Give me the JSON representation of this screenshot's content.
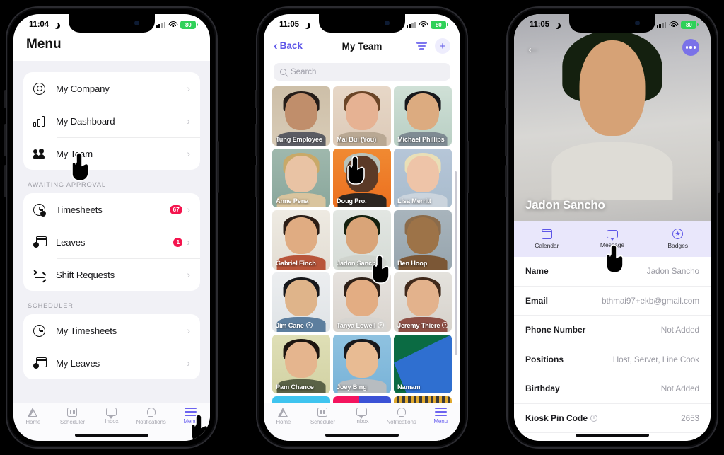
{
  "phones": [
    {
      "id": "menu-screen",
      "status": {
        "time": "11:04",
        "battery": "80",
        "moon_icon": "moon-icon",
        "signal_icon": "cellular-icon",
        "wifi_icon": "wifi-icon"
      },
      "title": "Menu",
      "groups": [
        {
          "label": "",
          "items": [
            {
              "icon": "gear-icon",
              "label": "My Company",
              "badge": ""
            },
            {
              "icon": "bar-chart-icon",
              "label": "My Dashboard",
              "badge": ""
            },
            {
              "icon": "people-icon",
              "label": "My Team",
              "badge": ""
            }
          ]
        },
        {
          "label": "AWAITING APPROVAL",
          "items": [
            {
              "icon": "clock-check-icon",
              "label": "Timesheets",
              "badge": "67"
            },
            {
              "icon": "calendar-minus-icon",
              "label": "Leaves",
              "badge": "1"
            },
            {
              "icon": "swap-arrows-icon",
              "label": "Shift Requests",
              "badge": ""
            }
          ]
        },
        {
          "label": "SCHEDULER",
          "items": [
            {
              "icon": "clock-icon",
              "label": "My Timesheets",
              "badge": ""
            },
            {
              "icon": "calendar-minus-icon",
              "label": "My Leaves",
              "badge": ""
            }
          ]
        }
      ],
      "tabbar": [
        {
          "icon": "home-icon",
          "label": "Home",
          "active": false
        },
        {
          "icon": "scheduler-icon",
          "label": "Scheduler",
          "active": false
        },
        {
          "icon": "inbox-icon",
          "label": "Inbox",
          "active": false
        },
        {
          "icon": "notifications-icon",
          "label": "Notifications",
          "active": false
        },
        {
          "icon": "menu-icon",
          "label": "Menu",
          "active": true
        }
      ]
    },
    {
      "id": "my-team-screen",
      "status": {
        "time": "11:05",
        "battery": "80"
      },
      "nav": {
        "back_label": "Back",
        "title": "My Team",
        "filter_icon": "filter-icon",
        "add_icon": "plus-icon"
      },
      "search": {
        "placeholder": "Search",
        "value": "",
        "icon": "search-icon"
      },
      "members": [
        {
          "name": "Tung Employee",
          "badge": ""
        },
        {
          "name": "Mai Bui (You)",
          "badge": ""
        },
        {
          "name": "Michael Phillips",
          "badge": ""
        },
        {
          "name": "Anne Pena",
          "badge": ""
        },
        {
          "name": "Doug Pro.",
          "badge": ""
        },
        {
          "name": "Lisa Merritt",
          "badge": ""
        },
        {
          "name": "Gabriel Finch",
          "badge": ""
        },
        {
          "name": "Jadon Sancho",
          "badge": ""
        },
        {
          "name": "Ben Hoop",
          "badge": ""
        },
        {
          "name": "Jim Cane",
          "badge": "z"
        },
        {
          "name": "Tanya Lowell",
          "badge": "z"
        },
        {
          "name": "Jeremy Thiere",
          "badge": "z"
        },
        {
          "name": "Pam Chance",
          "badge": ""
        },
        {
          "name": "Joey Bing",
          "badge": ""
        },
        {
          "name": "Namam",
          "badge": ""
        }
      ],
      "tabbar": [
        {
          "icon": "home-icon",
          "label": "Home",
          "active": false
        },
        {
          "icon": "scheduler-icon",
          "label": "Scheduler",
          "active": false
        },
        {
          "icon": "inbox-icon",
          "label": "Inbox",
          "active": false
        },
        {
          "icon": "notifications-icon",
          "label": "Notifications",
          "active": false
        },
        {
          "icon": "menu-icon",
          "label": "Menu",
          "active": true
        }
      ]
    },
    {
      "id": "profile-screen",
      "status": {
        "time": "11:05",
        "battery": "80"
      },
      "hero": {
        "back_icon": "arrow-left-icon",
        "more_icon": "more-options-icon",
        "name": "Jadon Sancho"
      },
      "actions": [
        {
          "icon": "calendar-icon",
          "label": "Calendar"
        },
        {
          "icon": "message-icon",
          "label": "Message"
        },
        {
          "icon": "badge-star-icon",
          "label": "Badges"
        }
      ],
      "details": [
        {
          "key": "Name",
          "value": "Jadon Sancho",
          "info_icon": ""
        },
        {
          "key": "Email",
          "value": "bthmai97+ekb@gmail.com",
          "info_icon": ""
        },
        {
          "key": "Phone Number",
          "value": "Not Added",
          "info_icon": ""
        },
        {
          "key": "Positions",
          "value": "Host, Server, Line Cook",
          "info_icon": ""
        },
        {
          "key": "Birthday",
          "value": "Not Added",
          "info_icon": ""
        },
        {
          "key": "Kiosk Pin Code",
          "value": "2653",
          "info_icon": "info-icon"
        }
      ]
    }
  ],
  "colors": {
    "accent_purple": "#5d56e8",
    "tab_bg": "#e9e7fb",
    "badge_red": "#f4144e",
    "battery_green": "#2ed158",
    "list_bg": "#f1f1f6"
  }
}
